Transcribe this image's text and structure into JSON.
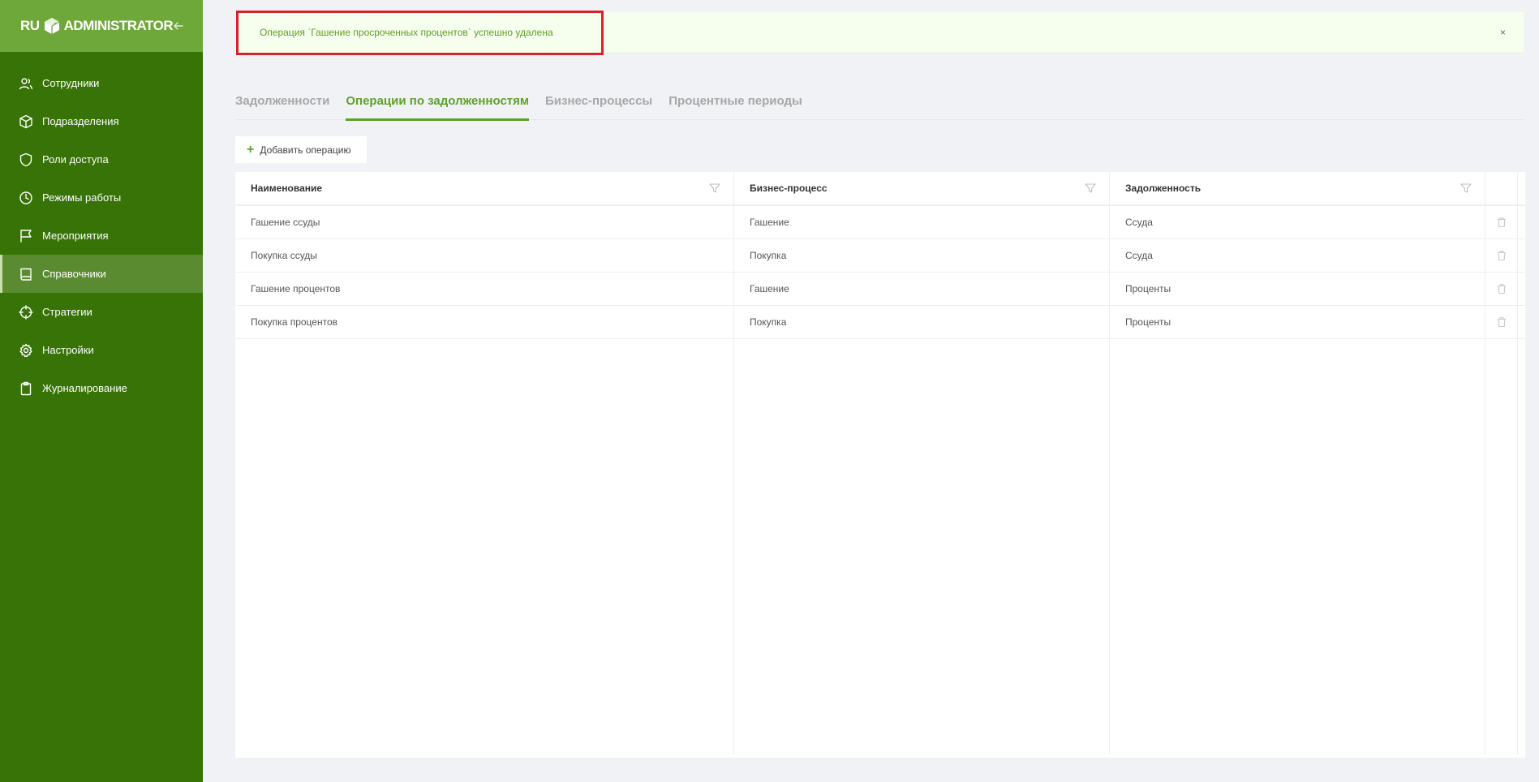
{
  "app": {
    "logo_prefix": "RU",
    "logo_text": "ADMINISTRATOR"
  },
  "sidebar": {
    "items": [
      {
        "label": "Сотрудники",
        "icon": "users-icon"
      },
      {
        "label": "Подразделения",
        "icon": "cube-icon"
      },
      {
        "label": "Роли доступа",
        "icon": "shield-icon"
      },
      {
        "label": "Режимы работы",
        "icon": "clock-icon"
      },
      {
        "label": "Мероприятия",
        "icon": "flag-icon"
      },
      {
        "label": "Справочники",
        "icon": "book-icon",
        "active": true
      },
      {
        "label": "Стратегии",
        "icon": "crosshair-icon"
      },
      {
        "label": "Настройки",
        "icon": "gear-icon"
      },
      {
        "label": "Журналирование",
        "icon": "clipboard-icon"
      }
    ]
  },
  "alert": {
    "message": "Операция `Гашение просроченных процентов` успешно удалена",
    "close": "×"
  },
  "tabs": [
    {
      "label": "Задолженности"
    },
    {
      "label": "Операции по задолженностям",
      "active": true
    },
    {
      "label": "Бизнес-процессы"
    },
    {
      "label": "Процентные периоды"
    }
  ],
  "toolbar": {
    "add_label": "Добавить операцию"
  },
  "table": {
    "columns": [
      "Наименование",
      "Бизнес-процесс",
      "Задолженность"
    ],
    "rows": [
      [
        "Гашение ссуды",
        "Гашение",
        "Ссуда"
      ],
      [
        "Покупка ссуды",
        "Покупка",
        "Ссуда"
      ],
      [
        "Гашение процентов",
        "Гашение",
        "Проценты"
      ],
      [
        "Покупка процентов",
        "Покупка",
        "Проценты"
      ]
    ]
  },
  "colors": {
    "sidebar": "#377307",
    "sidebar_header": "#6ea83a",
    "accent": "#5fa02a",
    "highlight": "#d9202a"
  }
}
